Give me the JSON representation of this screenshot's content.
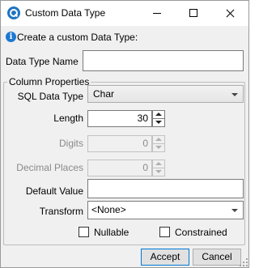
{
  "window": {
    "title": "Custom Data Type",
    "controls": {
      "minimize": "minimize",
      "maximize": "maximize",
      "close": "close"
    }
  },
  "info": {
    "text": "Create a custom Data Type:"
  },
  "form": {
    "data_type_name": {
      "label": "Data Type Name",
      "value": ""
    },
    "column_properties": {
      "legend": "Column Properties",
      "sql_data_type": {
        "label": "SQL Data Type",
        "value": "Char"
      },
      "length": {
        "label": "Length",
        "value": "30"
      },
      "digits": {
        "label": "Digits",
        "value": "0"
      },
      "decimal_places": {
        "label": "Decimal Places",
        "value": "0"
      },
      "default_value": {
        "label": "Default Value",
        "value": ""
      },
      "transform": {
        "label": "Transform",
        "value": "<None>"
      },
      "nullable": {
        "label": "Nullable",
        "checked": false
      },
      "constrained": {
        "label": "Constrained",
        "checked": false
      }
    }
  },
  "buttons": {
    "accept": "Accept",
    "cancel": "Cancel"
  },
  "icons": {
    "app": "database-search-icon",
    "info": "info-icon",
    "dropdown": "chevron-down-icon",
    "spinner": "spin-arrows-icon",
    "info_glyph": "i"
  }
}
